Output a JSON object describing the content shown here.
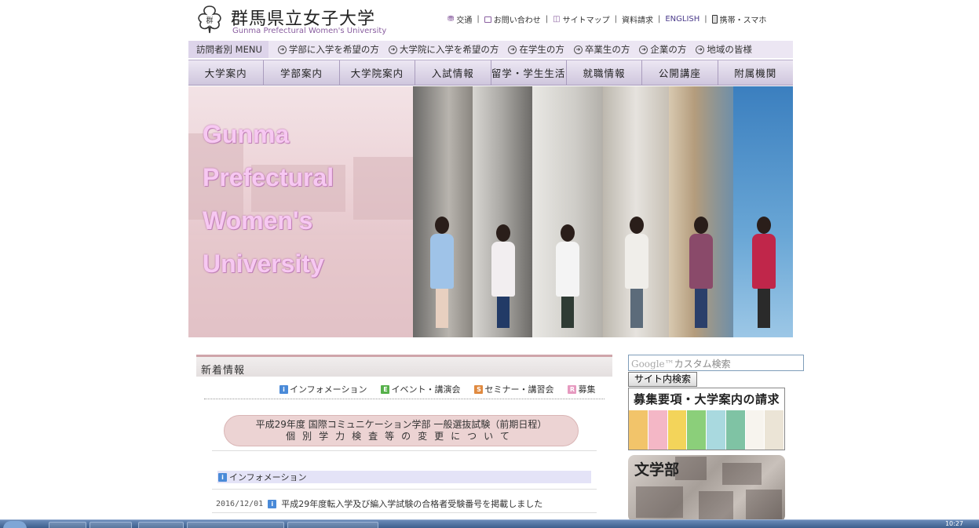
{
  "header": {
    "logo_jp": "群馬県立女子大学",
    "logo_en": "Gunma Prefectural Women's University",
    "util_links": [
      {
        "icon": "car-icon",
        "label": "交通"
      },
      {
        "icon": "mail-icon",
        "label": "お問い合わせ"
      },
      {
        "icon": "sitemap-icon",
        "label": "サイトマップ"
      },
      {
        "icon": "",
        "label": "資料請求"
      },
      {
        "icon": "",
        "label": "ENGLISH"
      },
      {
        "icon": "mobile-icon",
        "label": "携帯・スマホ"
      }
    ]
  },
  "visitor_menu": {
    "label": "訪問者別 MENU",
    "items": [
      "学部に入学を希望の方",
      "大学院に入学を希望の方",
      "在学生の方",
      "卒業生の方",
      "企業の方",
      "地域の皆様"
    ]
  },
  "global_nav": [
    "大学案内",
    "学部案内",
    "大学院案内",
    "入試情報",
    "留学・学生生活",
    "就職情報",
    "公開講座",
    "附属機関"
  ],
  "hero": {
    "lines": [
      "Gunma",
      "Prefectural",
      "Women's",
      "University"
    ]
  },
  "news": {
    "title": "新着情報",
    "categories": [
      {
        "mark": "i",
        "label": "インフォメーション",
        "color": "#4a8ad8"
      },
      {
        "mark": "E",
        "label": "イベント・講演会",
        "color": "#56b04a"
      },
      {
        "mark": "S",
        "label": "セミナー・講習会",
        "color": "#e08a40"
      },
      {
        "mark": "R",
        "label": "募集",
        "color": "#e69ac0"
      }
    ],
    "banner_line1": "平成29年度 国際コミュニケーション学部 一般選抜試験（前期日程）",
    "banner_line2": "個別学力検査等の変更について",
    "section_label": "インフォメーション",
    "items": [
      {
        "date": "2016/12/01",
        "text": "平成29年度転入学及び編入学試験の合格者受験番号を掲載しました"
      }
    ]
  },
  "sidebar": {
    "search_placeholder_brand": "Google™",
    "search_placeholder": "カスタム検索",
    "search_button": "サイト内検索",
    "banner_request": "募集要項・大学案内の請求",
    "banner_faculty": "文学部"
  },
  "taskbar": {
    "clock": "10:27"
  }
}
